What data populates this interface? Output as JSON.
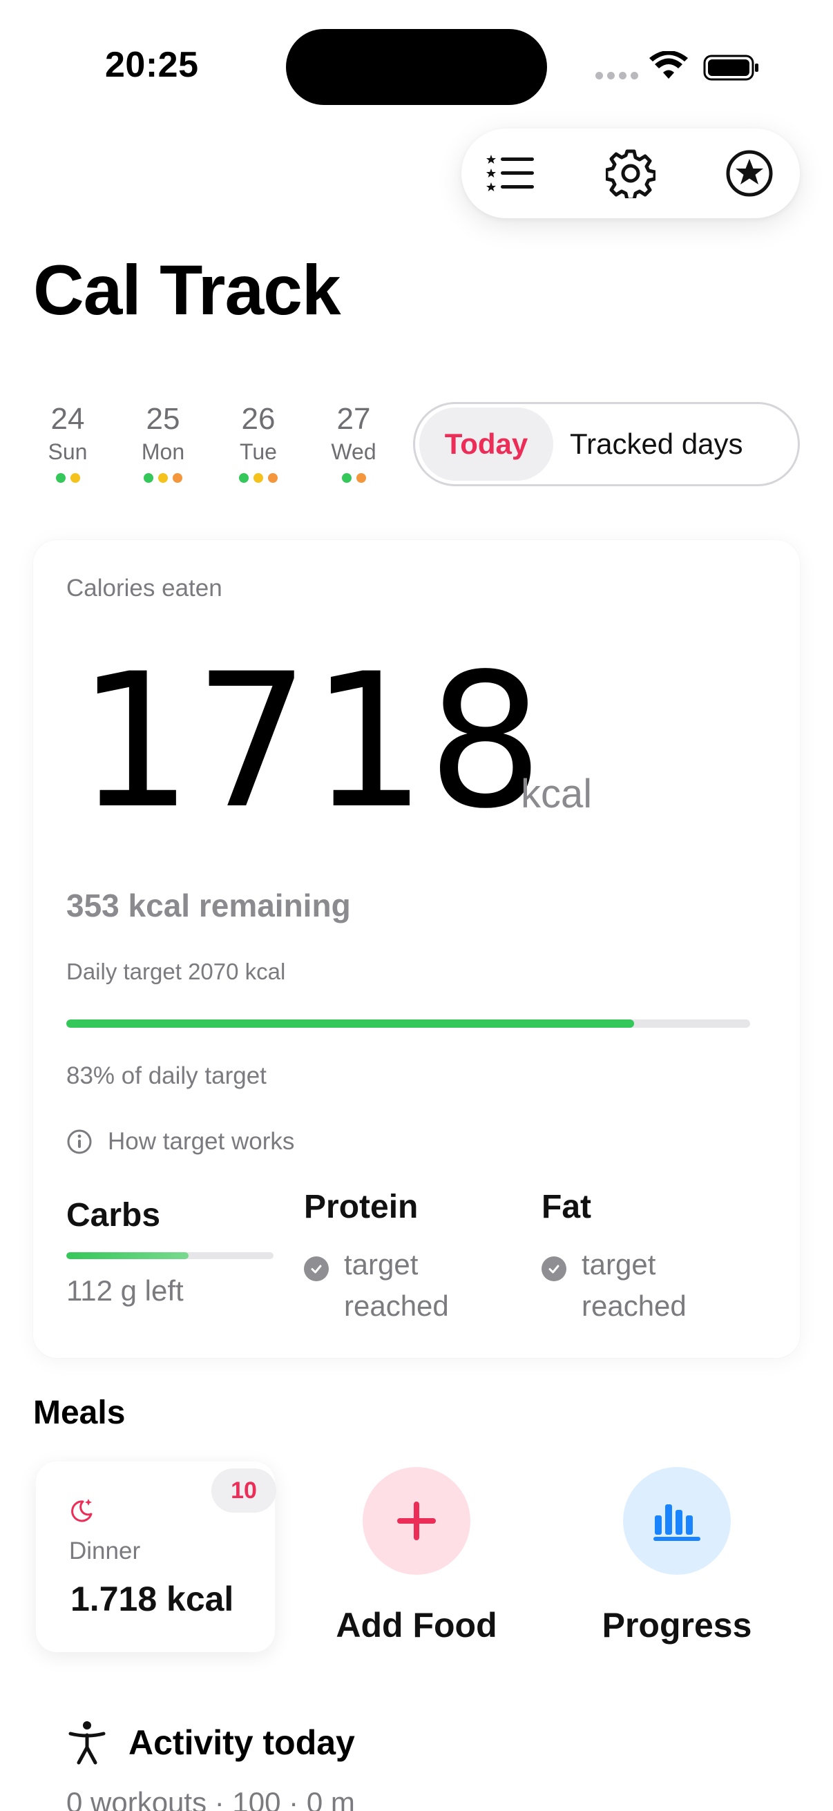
{
  "status_bar": {
    "time": "20:25"
  },
  "toolbar": {
    "list_icon": "list-stars-icon",
    "settings_icon": "gear-icon",
    "premium_icon": "star-circle-icon"
  },
  "app_title": "Cal Track",
  "days": [
    {
      "num": "24",
      "name": "Sun",
      "dots": [
        "#34c759",
        "#f4c21b"
      ]
    },
    {
      "num": "25",
      "name": "Mon",
      "dots": [
        "#34c759",
        "#f4c21b",
        "#f4963b"
      ]
    },
    {
      "num": "26",
      "name": "Tue",
      "dots": [
        "#34c759",
        "#f4c21b",
        "#f4963b"
      ]
    },
    {
      "num": "27",
      "name": "Wed",
      "dots": [
        "#34c759",
        "#f4963b"
      ]
    }
  ],
  "segment": {
    "today": "Today",
    "tracked": "Tracked days"
  },
  "calories": {
    "label": "Calories eaten",
    "value": "1718",
    "unit": "kcal",
    "remaining": "353 kcal remaining",
    "target": "Daily target 2070 kcal",
    "progress_fraction": 0.83,
    "percent_text": "83% of daily target",
    "how_text": "How target works"
  },
  "macros": {
    "carbs": {
      "title": "Carbs",
      "left": "112 g left",
      "progress_fraction": 0.59
    },
    "protein": {
      "title": "Protein",
      "status": "target reached"
    },
    "fat": {
      "title": "Fat",
      "status": "target reached"
    }
  },
  "meals": {
    "heading": "Meals",
    "dinner": {
      "badge": "10",
      "label": "Dinner",
      "kcal": "1.718 kcal",
      "icon": "moon-stars-icon"
    },
    "add_food": "Add Food",
    "progress": "Progress"
  },
  "activity": {
    "title": "Activity today",
    "summary": "0 workouts · 100 · 0 m"
  },
  "colors": {
    "accent": "#ec2d57",
    "green": "#34c759",
    "blue": "#1a84ff",
    "pink_bg": "#ffdfe6",
    "blue_bg": "#ddeeff"
  }
}
